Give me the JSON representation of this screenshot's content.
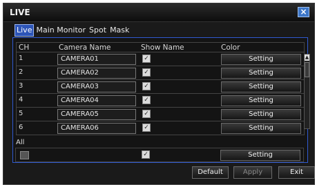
{
  "window": {
    "title": "LIVE",
    "close_label": "×"
  },
  "tabs": [
    {
      "label": "Live",
      "active": true
    },
    {
      "label": "Main Monitor",
      "active": false
    },
    {
      "label": "Spot",
      "active": false
    },
    {
      "label": "Mask",
      "active": false
    }
  ],
  "table": {
    "headers": {
      "ch": "CH",
      "camera_name": "Camera Name",
      "show_name": "Show Name",
      "color": "Color"
    },
    "rows": [
      {
        "ch": "1",
        "name": "CAMERA01",
        "show": true,
        "color_button": "Setting"
      },
      {
        "ch": "2",
        "name": "CAMERA02",
        "show": true,
        "color_button": "Setting"
      },
      {
        "ch": "3",
        "name": "CAMERA03",
        "show": true,
        "color_button": "Setting"
      },
      {
        "ch": "4",
        "name": "CAMERA04",
        "show": true,
        "color_button": "Setting"
      },
      {
        "ch": "5",
        "name": "CAMERA05",
        "show": true,
        "color_button": "Setting"
      },
      {
        "ch": "6",
        "name": "CAMERA06",
        "show": true,
        "color_button": "Setting"
      }
    ]
  },
  "all": {
    "label": "All",
    "show": true,
    "color_button": "Setting"
  },
  "footer": {
    "default_label": "Default",
    "apply_label": "Apply",
    "exit_label": "Exit"
  },
  "colors": {
    "accent": "#2d55b8",
    "panel_border": "#2f5ad1",
    "background": "#1a1a1a"
  },
  "icons": {
    "close": "close-icon",
    "check": "check-icon",
    "scroll_up": "scroll-up-arrow-icon"
  }
}
